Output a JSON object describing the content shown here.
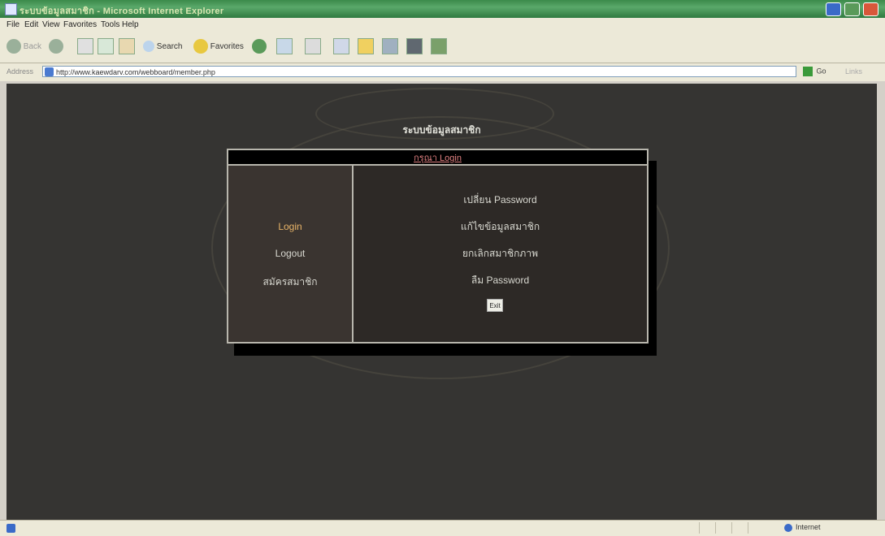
{
  "window": {
    "title": "ระบบข้อมูลสมาชิก - Microsoft Internet Explorer"
  },
  "menu": [
    "File",
    "Edit",
    "View",
    "Favorites",
    "Tools",
    "Help"
  ],
  "toolbar": {
    "back": "Back",
    "search": "Search",
    "favorites": "Favorites"
  },
  "address": {
    "label": "Address",
    "url": "http://www.kaewdarv.com/webboard/member.php",
    "go": "Go",
    "links": "Links"
  },
  "page": {
    "heading": "ระบบข้อมูลสมาชิก",
    "panel_title": "กรุณา Login",
    "left_nav": [
      "Login",
      "Logout",
      "สมัครสมาชิก"
    ],
    "options": [
      "เปลี่ยน Password",
      "แก้ไขข้อมูลสมาชิก",
      "ยกเลิกสมาชิกภาพ",
      "ลืม Password"
    ],
    "exit": "Exit"
  },
  "status": {
    "zone": "Internet"
  },
  "colors": {
    "page_bg": "#353432",
    "active_link": "#e8b468",
    "title_link": "#e08080"
  }
}
